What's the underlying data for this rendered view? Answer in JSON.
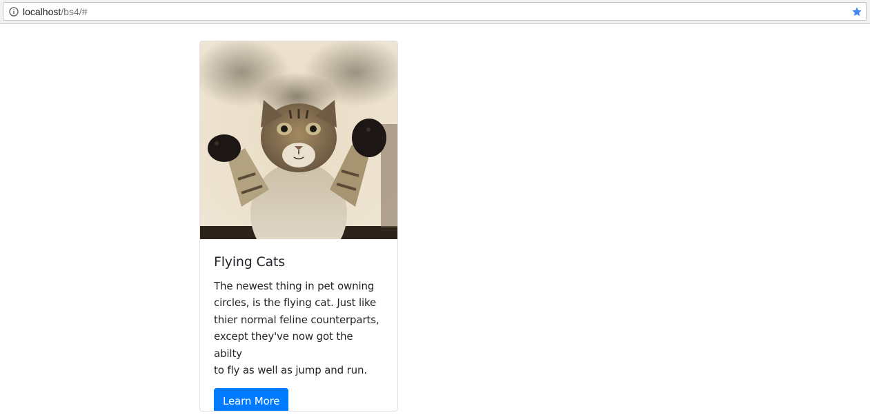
{
  "browser": {
    "url_host": "localhost",
    "url_path": "/bs4/#",
    "info_icon": "info-circle-icon",
    "bookmark_icon": "star-icon",
    "bookmark_color": "#4285f4"
  },
  "card": {
    "image_alt": "flying cat photo",
    "title": "Flying Cats",
    "text_lines": [
      "The newest thing in pet owning",
      "circles, is the flying cat. Just like",
      "thier normal feline counterparts,",
      "except they've now got the abilty",
      "to fly as well as jump and run."
    ],
    "button_label": "Learn More",
    "button_color": "#007bff"
  }
}
